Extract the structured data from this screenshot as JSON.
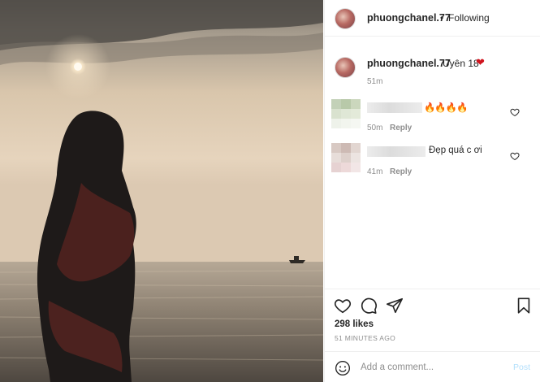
{
  "post": {
    "username": "phuongchanel.77",
    "separator": "•",
    "follow_status": "Following"
  },
  "caption": {
    "username": "phuongchanel.77",
    "text": "Uyên 18",
    "emoji": "❤",
    "time": "51m"
  },
  "comments": [
    {
      "text": "🔥🔥🔥🔥",
      "time": "50m",
      "reply_label": "Reply",
      "mosaic": [
        "#c3d1b8",
        "#b8c9a9",
        "#cbd7bd",
        "#d9e2cf",
        "#dfe7d6",
        "#e3ead9",
        "#eef2ea",
        "#f2f5ee",
        "#f5f7f2"
      ]
    },
    {
      "text": "Đẹp quá c ơi",
      "time": "41m",
      "reply_label": "Reply",
      "mosaic": [
        "#d8c9c3",
        "#cdbab4",
        "#e2d6d1",
        "#e7ddd9",
        "#ddd0cb",
        "#ece4e1",
        "#e6d2d2",
        "#edd9d9",
        "#f2e6e6"
      ]
    }
  ],
  "likes": "298 likes",
  "posted_ago": "51 MINUTES AGO",
  "add_comment": {
    "placeholder": "Add a comment...",
    "post_label": "Post"
  },
  "colors": {
    "accent": "#0095f6",
    "post_disabled": "#b2dffc",
    "heart": "#d0141e"
  },
  "icons": [
    "heart-icon",
    "comment-icon",
    "share-icon",
    "bookmark-icon",
    "emoji-icon"
  ]
}
